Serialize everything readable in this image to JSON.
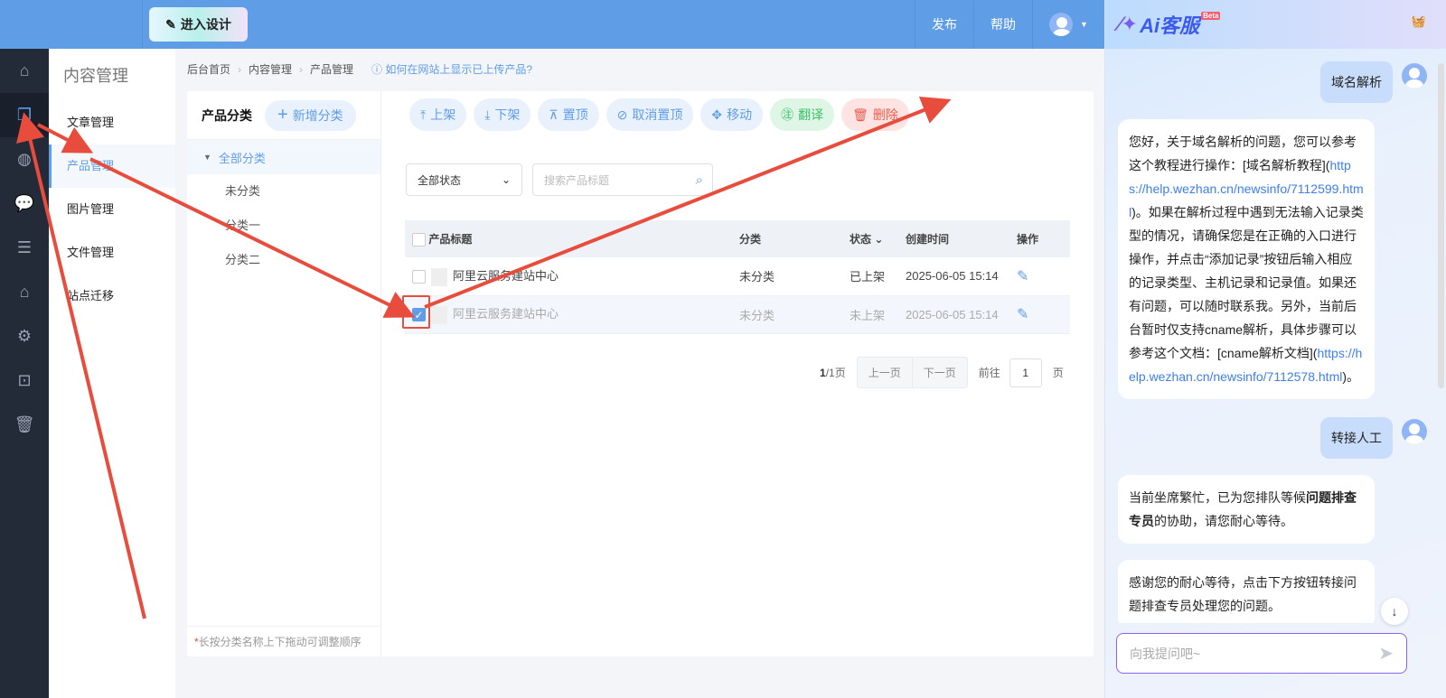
{
  "topbar": {
    "design_button": "进入设计",
    "publish": "发布",
    "help": "帮助"
  },
  "rail": {
    "icons": [
      "home-icon",
      "content-icon",
      "globe-icon",
      "wechat-icon",
      "list-icon",
      "shop-icon",
      "gear-icon",
      "terminal-icon",
      "trash-icon"
    ],
    "active_index": 1
  },
  "submenu": {
    "title": "内容管理",
    "items": [
      "文章管理",
      "产品管理",
      "图片管理",
      "文件管理",
      "站点迁移"
    ],
    "active_index": 1
  },
  "breadcrumb": {
    "items": [
      "后台首页",
      "内容管理",
      "产品管理"
    ],
    "help_link": "如何在网站上显示已上传产品?"
  },
  "categories": {
    "title": "产品分类",
    "add_button": "新增分类",
    "all": "全部分类",
    "items": [
      "未分类",
      "分类一",
      "分类二"
    ],
    "footer_mark": "*",
    "footer": "长按分类名称上下拖动可调整顺序"
  },
  "toolbar": {
    "shelve": "上架",
    "unshelve": "下架",
    "pin": "置顶",
    "unpin": "取消置顶",
    "move": "移动",
    "translate": "翻译",
    "delete": "删除"
  },
  "filter": {
    "status_select": "全部状态",
    "search_placeholder": "搜索产品标题"
  },
  "table": {
    "headers": {
      "title": "产品标题",
      "category": "分类",
      "status": "状态",
      "created": "创建时间",
      "actions": "操作"
    },
    "rows": [
      {
        "title": "阿里云服务建站中心",
        "category": "未分类",
        "status": "已上架",
        "created": "2025-06-05 15:14",
        "checked": false
      },
      {
        "title": "阿里云服务建站中心",
        "category": "未分类",
        "status": "未上架",
        "created": "2025-06-05 15:14",
        "checked": true
      }
    ]
  },
  "pagination": {
    "current": "1",
    "total": "/1页",
    "prev": "上一页",
    "next": "下一页",
    "goto_label": "前往",
    "page_input": "1",
    "page_suffix": "页"
  },
  "chat": {
    "logo": "Ai客服",
    "beta": "Beta",
    "messages": [
      {
        "role": "user",
        "segments": [
          {
            "t": "域名解析"
          }
        ]
      },
      {
        "role": "bot",
        "segments": [
          {
            "t": "您好，关于域名解析的问题，您可以参考这个教程进行操作：[域名解析教程]("
          },
          {
            "t": "https://help.wezhan.cn/newsinfo/7112599.html",
            "link": true
          },
          {
            "t": ")。如果在解析过程中遇到无法输入记录类型的情况，请确保您是在正确的入口进行操作，并点击“添加记录”按钮后输入相应的记录类型、主机记录和记录值。如果还有问题，可以随时联系我。另外，当前后台暂时仅支持cname解析，具体步骤可以参考这个文档：[cname解析文档]("
          },
          {
            "t": "https://help.wezhan.cn/newsinfo/7112578.html",
            "link": true
          },
          {
            "t": ")。"
          }
        ]
      },
      {
        "role": "user",
        "segments": [
          {
            "t": "转接人工"
          }
        ]
      },
      {
        "role": "bot",
        "segments": [
          {
            "t": "当前坐席繁忙，已为您排队等候"
          },
          {
            "t": "问题排查专员",
            "bold": true
          },
          {
            "t": "的协助，请您耐心等待。"
          }
        ]
      },
      {
        "role": "bot",
        "segments": [
          {
            "t": "感谢您的耐心等待，点击下方按钮转接问题排查专员处理您的问题。"
          }
        ]
      }
    ],
    "input_placeholder": "向我提问吧~"
  }
}
